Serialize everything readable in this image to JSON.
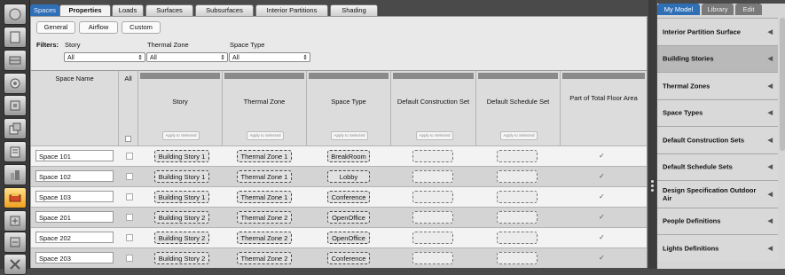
{
  "top_tabs": [
    {
      "label": "Spaces",
      "state": "active"
    },
    {
      "label": "Properties",
      "state": "selected"
    },
    {
      "label": "Loads",
      "state": ""
    },
    {
      "label": "Surfaces",
      "state": ""
    },
    {
      "label": "Subsurfaces",
      "state": ""
    },
    {
      "label": "Interior Partitions",
      "state": ""
    },
    {
      "label": "Shading",
      "state": ""
    }
  ],
  "sub_tabs": [
    "General",
    "Airflow",
    "Custom"
  ],
  "filters": {
    "label": "Filters:",
    "story": {
      "label": "Story",
      "value": "All"
    },
    "thermal_zone": {
      "label": "Thermal Zone",
      "value": "All"
    },
    "space_type": {
      "label": "Space Type",
      "value": "All"
    }
  },
  "table": {
    "headers": {
      "space_name": "Space Name",
      "all": "All",
      "story": "Story",
      "thermal_zone": "Thermal Zone",
      "space_type": "Space Type",
      "default_construction_set": "Default Construction Set",
      "default_schedule_set": "Default Schedule Set",
      "part_of_total_floor_area": "Part of Total Floor Area"
    },
    "apply_label": "Apply to Selected",
    "rows": [
      {
        "name": "Space 101",
        "story": "Building Story 1",
        "zone": "Thermal Zone 1",
        "type": "BreakRoom",
        "floor": "✓"
      },
      {
        "name": "Space 102",
        "story": "Building Story 1",
        "zone": "Thermal Zone 1",
        "type": "Lobby",
        "floor": "✓"
      },
      {
        "name": "Space 103",
        "story": "Building Story 1",
        "zone": "Thermal Zone 1",
        "type": "Conference",
        "floor": "✓"
      },
      {
        "name": "Space 201",
        "story": "Building Story 2",
        "zone": "Thermal Zone 2",
        "type": "OpenOffice",
        "floor": "✓"
      },
      {
        "name": "Space 202",
        "story": "Building Story 2",
        "zone": "Thermal Zone 2",
        "type": "OpenOffice",
        "floor": "✓"
      },
      {
        "name": "Space 203",
        "story": "Building Story 2",
        "zone": "Thermal Zone 2",
        "type": "Conference",
        "floor": "✓"
      }
    ]
  },
  "right_tabs": [
    "My Model",
    "Library",
    "Edit"
  ],
  "right_items": [
    {
      "label": "Interior Partition Surface",
      "active": false
    },
    {
      "label": "Building Stories",
      "active": true
    },
    {
      "label": "Thermal Zones",
      "active": false
    },
    {
      "label": "Space Types",
      "active": false
    },
    {
      "label": "Default Construction Sets",
      "active": false
    },
    {
      "label": "Default Schedule Sets",
      "active": false
    },
    {
      "label": "Design Specification Outdoor Air",
      "active": false
    },
    {
      "label": "People Definitions",
      "active": false
    },
    {
      "label": "Lights Definitions",
      "active": false
    }
  ],
  "right_arrow": "◀",
  "select_arrow": "⇕",
  "toolbar_icons": [
    "site-icon",
    "schedules-icon",
    "constructions-icon",
    "loads-icon",
    "space-types-icon",
    "geometry-icon",
    "facility-icon",
    "spaces-icon",
    "thermal-zones-icon",
    "hvac-icon",
    "outputs-icon",
    "measures-icon"
  ],
  "colors": {
    "accent": "#2f6fb6",
    "active_tool": "#f0a020"
  }
}
